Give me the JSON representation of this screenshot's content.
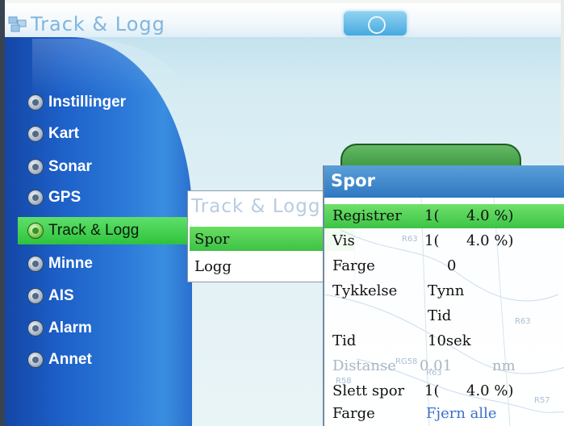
{
  "app": {
    "title": "Track & Logg"
  },
  "menu": {
    "items": [
      {
        "label": "Instillinger",
        "icon": "settings-icon"
      },
      {
        "label": "Kart",
        "icon": "chart-icon"
      },
      {
        "label": "Sonar",
        "icon": "sonar-icon"
      },
      {
        "label": "GPS",
        "icon": "gps-icon"
      },
      {
        "label": "Track & Logg",
        "icon": "track-icon",
        "selected": true
      },
      {
        "label": "Minne",
        "icon": "memory-icon"
      },
      {
        "label": "AIS",
        "icon": "ais-icon"
      },
      {
        "label": "Alarm",
        "icon": "alarm-icon"
      },
      {
        "label": "Annet",
        "icon": "other-icon"
      }
    ]
  },
  "submenu": {
    "title": "Track & Logg",
    "items": [
      {
        "label": "Spor",
        "selected": true
      },
      {
        "label": "Logg",
        "selected": false
      }
    ]
  },
  "spor": {
    "title": "Spor",
    "rows": [
      {
        "label": "Registrer",
        "value": "1(",
        "value2": "4.0 %)",
        "selected": true
      },
      {
        "label": "Vis",
        "value": "1(",
        "value2": "4.0 %)"
      },
      {
        "label": "Farge",
        "value": "0"
      },
      {
        "label": "Tykkelse",
        "value": "Tynn"
      },
      {
        "label": "",
        "value": "Tid"
      },
      {
        "label": "Tid",
        "value": "10sek"
      },
      {
        "label": "Distanse",
        "value": "0.01",
        "unit": "nm",
        "disabled": true
      },
      {
        "label": "Slett spor",
        "value": "1(",
        "value2": "4.0 %)"
      },
      {
        "label": "Farge",
        "value": "Fjern alle"
      }
    ],
    "chart_numbers": [
      "R63",
      "R63",
      "RG58",
      "R63",
      "R58",
      "R57"
    ]
  },
  "colors": {
    "accent_green": "#3ec246",
    "panel_blue": "#1d60c8",
    "header_blue": "#2f78c2"
  }
}
